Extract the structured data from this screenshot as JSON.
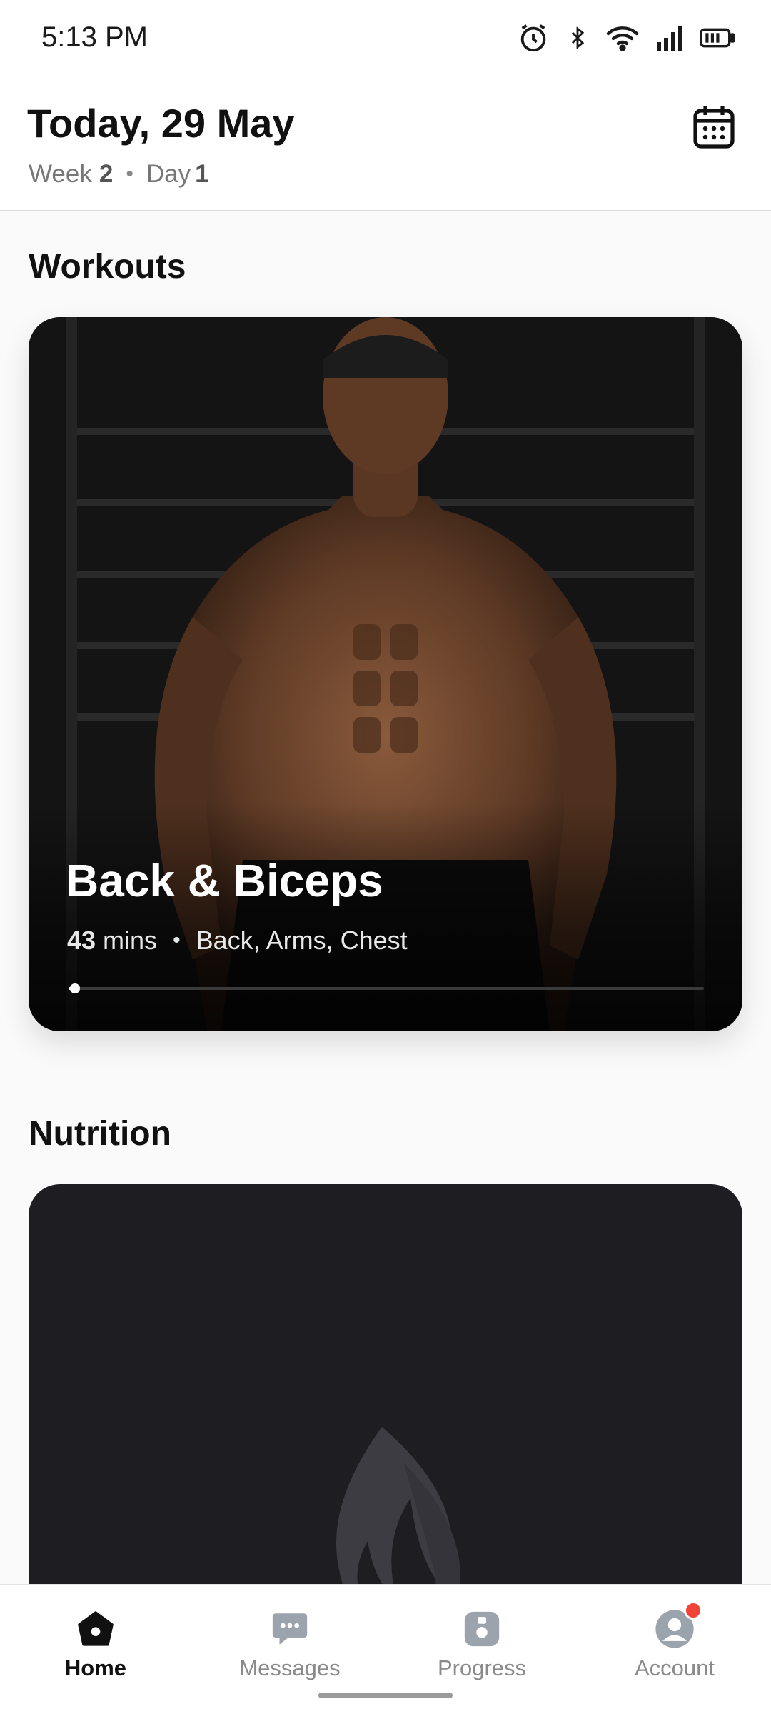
{
  "status_bar": {
    "time": "5:13 PM",
    "icons": [
      "alarm-icon",
      "bluetooth-icon",
      "wifi-icon",
      "signal-icon",
      "battery-icon"
    ]
  },
  "header": {
    "title": "Today, 29 May",
    "week_label": "Week",
    "week_value": "2",
    "day_label": "Day",
    "day_value": "1",
    "calendar_icon": "calendar-icon"
  },
  "sections": {
    "workouts_title": "Workouts",
    "nutrition_title": "Nutrition"
  },
  "workout_card": {
    "name": "Back & Biceps",
    "duration_value": "43",
    "duration_unit": "mins",
    "muscles": "Back, Arms, Chest",
    "progress_fraction": 0.01
  },
  "nutrition_card": {
    "icon": "flame-icon"
  },
  "bottom_nav": {
    "items": [
      {
        "label": "Home",
        "icon": "home-icon",
        "active": true
      },
      {
        "label": "Messages",
        "icon": "messages-icon",
        "active": false
      },
      {
        "label": "Progress",
        "icon": "progress-icon",
        "active": false
      },
      {
        "label": "Account",
        "icon": "account-icon",
        "active": false,
        "has_notification": true
      }
    ]
  },
  "colors": {
    "accent": "#111111",
    "inactive": "#8a8a8a",
    "badge": "#f04438",
    "card_dark": "#1e1e22"
  }
}
